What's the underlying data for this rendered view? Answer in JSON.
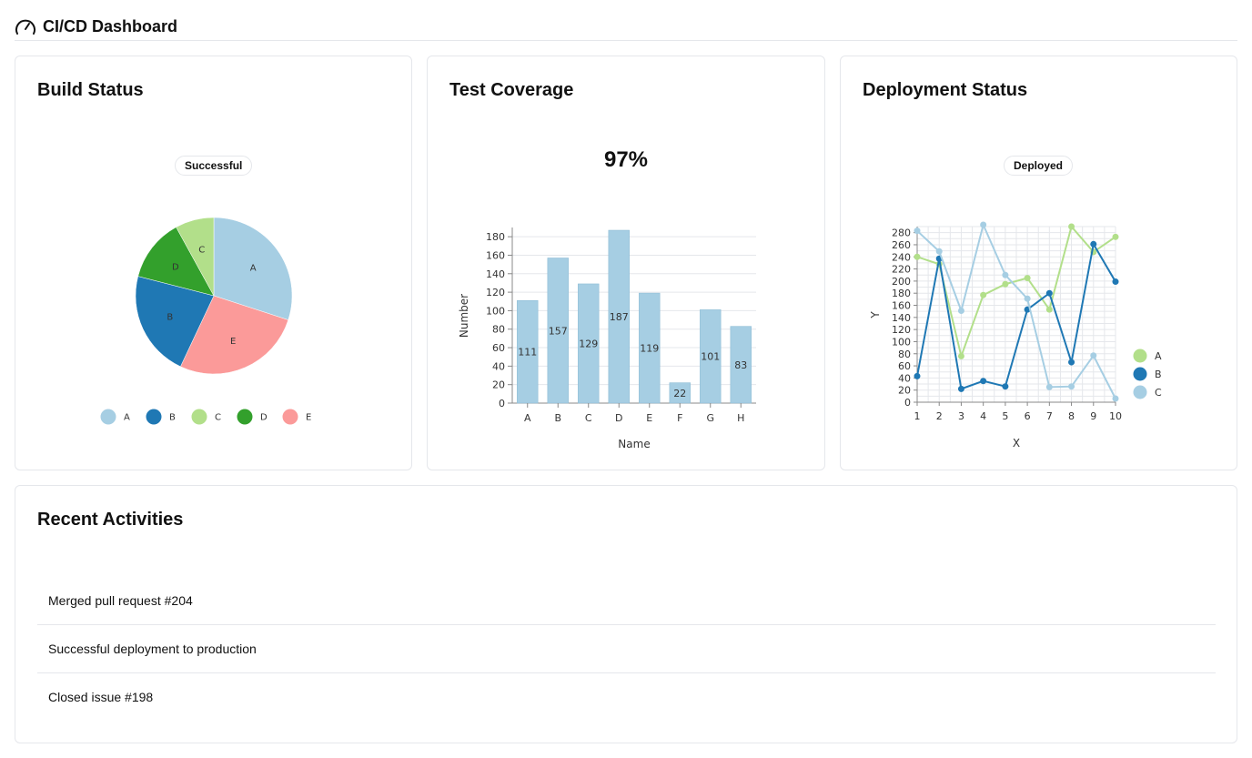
{
  "header": {
    "title": "CI/CD Dashboard",
    "icon": "gauge-icon"
  },
  "build_status": {
    "title": "Build Status",
    "badge": "Successful"
  },
  "test_coverage": {
    "title": "Test Coverage",
    "metric": "97%"
  },
  "deployment_status": {
    "title": "Deployment Status",
    "badge": "Deployed"
  },
  "recent_activities": {
    "title": "Recent Activities",
    "items": [
      "Merged pull request #204",
      "Successful deployment to production",
      "Closed issue #198"
    ]
  },
  "chart_data": [
    {
      "type": "pie",
      "labels": [
        "A",
        "B",
        "C",
        "D",
        "E"
      ],
      "values": [
        30,
        22,
        8,
        13,
        27
      ],
      "order": [
        "A",
        "E",
        "B",
        "D",
        "C"
      ],
      "colors": {
        "A": "#a6cee3",
        "B": "#1f78b4",
        "C": "#b2df8a",
        "D": "#33a02c",
        "E": "#fb9a99"
      },
      "legend": "bottom"
    },
    {
      "type": "bar",
      "categories": [
        "A",
        "B",
        "C",
        "D",
        "E",
        "F",
        "G",
        "H"
      ],
      "values": [
        111,
        157,
        129,
        187,
        119,
        22,
        101,
        83
      ],
      "xlabel": "Name",
      "ylabel": "Number",
      "ylim": [
        0,
        190
      ],
      "yticks": [
        0,
        20,
        40,
        60,
        80,
        100,
        120,
        140,
        160,
        180
      ],
      "color": "#a6cee3",
      "grid": true
    },
    {
      "type": "line",
      "x": [
        1,
        2,
        3,
        4,
        5,
        6,
        7,
        8,
        9,
        10
      ],
      "series": [
        {
          "name": "A",
          "color": "#b2df8a",
          "values": [
            240,
            228,
            76,
            177,
            195,
            205,
            153,
            290,
            248,
            273
          ]
        },
        {
          "name": "B",
          "color": "#1f78b4",
          "values": [
            43,
            237,
            22,
            35,
            26,
            153,
            180,
            66,
            261,
            199
          ]
        },
        {
          "name": "C",
          "color": "#a6cee3",
          "values": [
            283,
            249,
            151,
            293,
            210,
            171,
            25,
            26,
            77,
            6
          ]
        }
      ],
      "xlabel": "X",
      "ylabel": "Y",
      "ylim": [
        0,
        290
      ],
      "yticks": [
        0,
        20,
        40,
        60,
        80,
        100,
        120,
        140,
        160,
        180,
        200,
        220,
        240,
        260,
        280
      ],
      "grid": true,
      "legend": "right"
    }
  ]
}
